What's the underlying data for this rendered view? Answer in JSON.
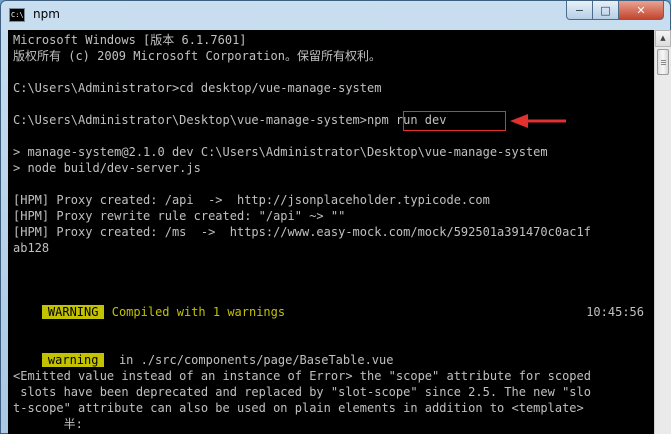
{
  "window": {
    "title": "npm",
    "icon_text": "C:\\",
    "controls": {
      "minimize": "−",
      "maximize": "□",
      "close": "✕"
    }
  },
  "console": {
    "lines": {
      "l1": "Microsoft Windows [版本 6.1.7601]",
      "l2": "版权所有 (c) 2009 Microsoft Corporation。保留所有权利。",
      "l3": "C:\\Users\\Administrator>cd desktop/vue-manage-system",
      "l4": "C:\\Users\\Administrator\\Desktop\\vue-manage-system>npm run dev",
      "l5": "> manage-system@2.1.0 dev C:\\Users\\Administrator\\Desktop\\vue-manage-system",
      "l6": "> node build/dev-server.js",
      "l7": "[HPM] Proxy created: /api  ->  http://jsonplaceholder.typicode.com",
      "l8": "[HPM] Proxy rewrite rule created: \"/api\" ~> \"\"",
      "l9": "[HPM] Proxy created: /ms  ->  https://www.easy-mock.com/mock/592501a391470c0ac1f",
      "l10": "ab128",
      "l13": "<Emitted value instead of an instance of Error> the \"scope\" attribute for scoped",
      "l14": " slots have been deprecated and replaced by \"slot-scope\" since 2.5. The new \"slo",
      "l15": "t-scope\" attribute can also be used on plain elements in addition to <template>",
      "l16": "       半:"
    },
    "warning_line": {
      "badge": "WARNING",
      "text": "Compiled with 1 warnings",
      "time": "10:45:56"
    },
    "warning_detail": {
      "badge": "warning",
      "text": "in ./src/components/page/BaseTable.vue"
    },
    "highlight_color": "#e03030",
    "badge_color": "#c2c200"
  },
  "scrollbar": {
    "up_arrow": "▲"
  }
}
